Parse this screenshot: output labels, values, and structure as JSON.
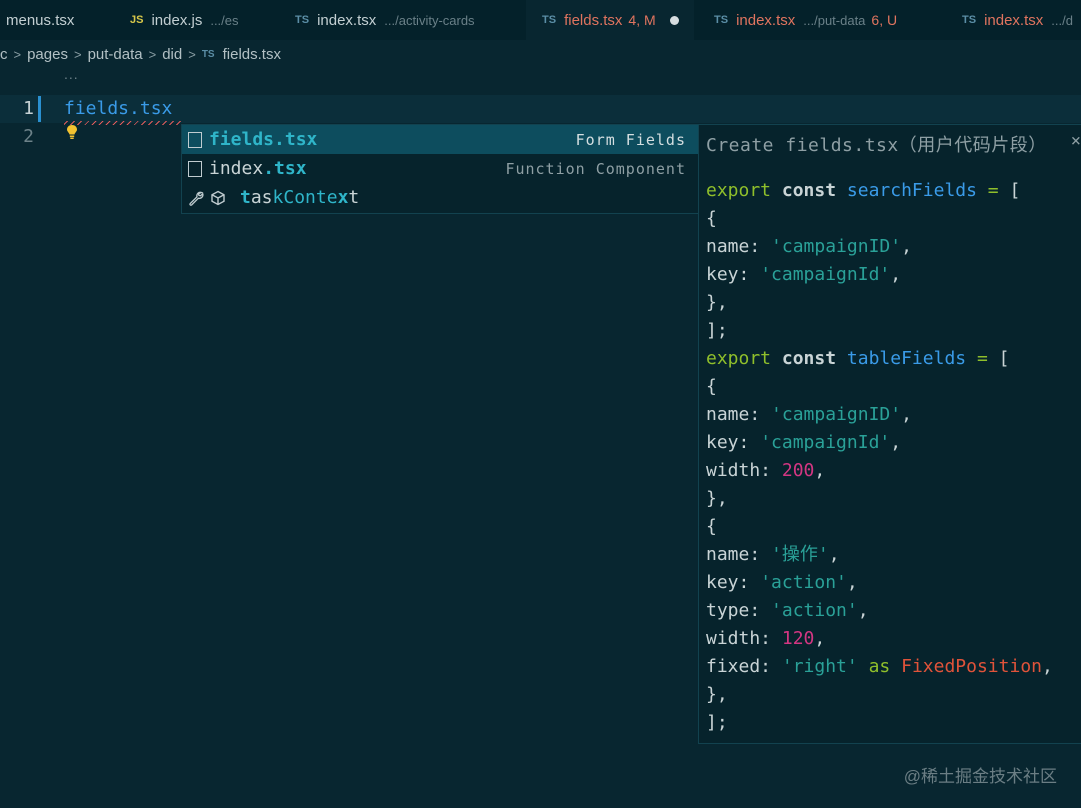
{
  "tabs": [
    {
      "lang": "",
      "name": "menus.tsx",
      "desc": "",
      "active": false
    },
    {
      "lang": "JS",
      "name": "index.js",
      "desc": ".../es",
      "active": false
    },
    {
      "lang": "TS",
      "name": "index.tsx",
      "desc": ".../activity-cards",
      "active": false
    },
    {
      "lang": "TS",
      "name": "fields.tsx",
      "desc": "4, M",
      "active": true
    },
    {
      "lang": "TS",
      "name": "index.tsx",
      "desc": ".../put-data",
      "status": "6, U",
      "active": false
    },
    {
      "lang": "TS",
      "name": "index.tsx",
      "desc": ".../d",
      "active": false
    }
  ],
  "breadcrumb": {
    "items": [
      "c",
      "pages",
      "put-data",
      "did"
    ],
    "file_lang": "TS",
    "file": "fields.tsx",
    "ellipsis": "..."
  },
  "editor": {
    "line_numbers": [
      "1",
      "2"
    ],
    "line1_text": "fields.tsx",
    "lightbulb_icon": "lightbulb-icon"
  },
  "suggest": {
    "items": [
      {
        "icon": "file-icon",
        "label_pre": "",
        "label_hl": "fields.tsx",
        "label_post": "",
        "detail": "Form Fields"
      },
      {
        "icon": "file-icon",
        "label_pre": "index",
        "label_hl": ".tsx",
        "label_post": "",
        "detail": "Function Component"
      },
      {
        "icons": [
          "wrench-icon",
          "cube-icon"
        ],
        "label_parts": [
          "t",
          "as",
          "kConte",
          "x",
          "t"
        ],
        "detail": ""
      }
    ]
  },
  "details": {
    "title": "Create fields.tsx（用户代码片段）",
    "close": "×",
    "code": {
      "export": "export",
      "const": "const",
      "searchFields": "searchFields",
      "tableFields": "tableFields",
      "eq": "=",
      "ob": "[",
      "name": "name:",
      "key": "key:",
      "width": "width:",
      "type": "type:",
      "fixed": "fixed:",
      "campaignID": "'campaignID'",
      "campaignId": "'campaignId'",
      "w200": "200",
      "w120": "120",
      "caozuo": "'操作'",
      "action": "'action'",
      "right": "'right'",
      "as": "as",
      "FixedPosition": "FixedPosition",
      "l_open": "{",
      "l_close": "},",
      "l_end": "];"
    }
  },
  "watermark": "@稀土掘金技术社区"
}
